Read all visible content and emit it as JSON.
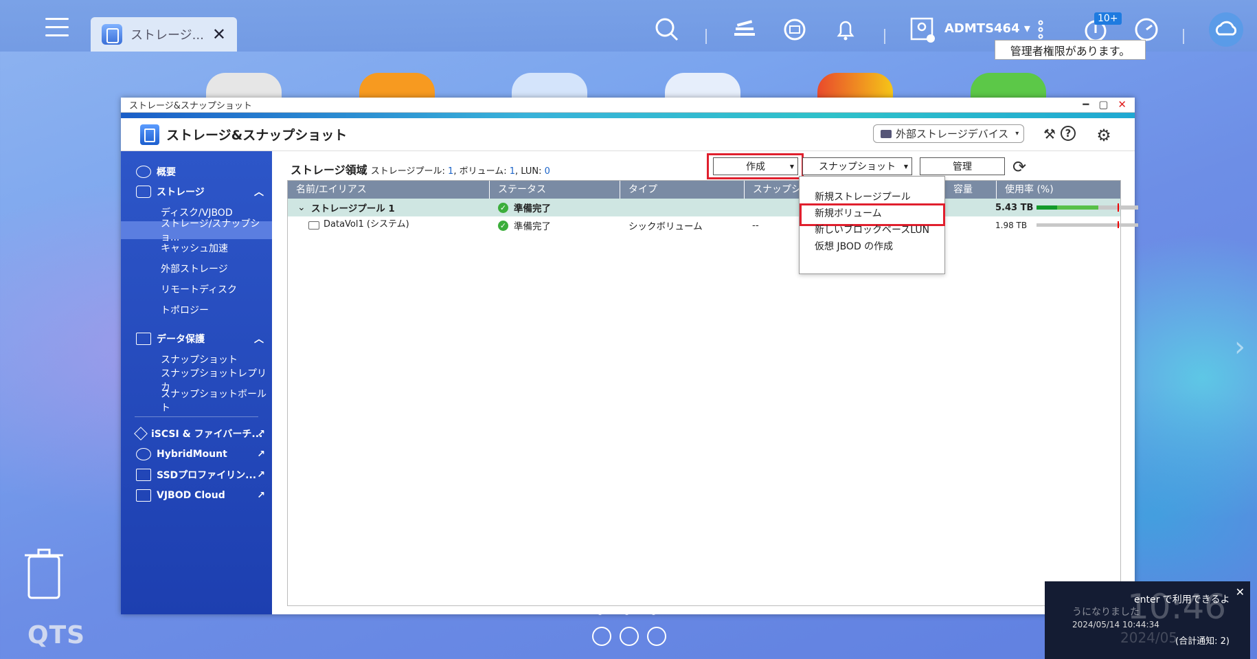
{
  "taskbar": {
    "tab_label": "ストレージ...",
    "tab_close": "✕",
    "user": "ADMTS464 ▾",
    "badge": "10+",
    "tooltip": "管理者権限があります。"
  },
  "window": {
    "titlebar": "ストレージ&スナップショット",
    "app_title": "ストレージ&スナップショット",
    "ext_device": "外部ストレージデバイス",
    "min": "━",
    "max": "▢",
    "close": "✕"
  },
  "sidebar": {
    "overview": "概要",
    "storage": "ストレージ",
    "storage_items": [
      "ディスク/VJBOD",
      "ストレージ/スナップショ...",
      "キャッシュ加速",
      "外部ストレージ",
      "リモートディスク",
      "トポロジー"
    ],
    "data_protect": "データ保護",
    "protect_items": [
      "スナップショット",
      "スナップショットレプリカ",
      "スナップショットボールト"
    ],
    "links": [
      "iSCSI & ファイバーチ...",
      "HybridMount",
      "SSDプロファイリン...",
      "VJBOD Cloud"
    ]
  },
  "content": {
    "title": "ストレージ領域",
    "summary_pool_label": "ストレージプール: ",
    "summary_pool": "1",
    "summary_vol_label": ", ボリューム: ",
    "summary_vol": "1",
    "summary_lun_label": ", LUN: ",
    "summary_lun": "0",
    "btn_create": "作成",
    "btn_snapshot": "スナップショット",
    "btn_manage": "管理",
    "columns": [
      "名前/エイリアス",
      "ステータス",
      "タイプ",
      "スナップシ",
      "容量",
      "使用率 (%)"
    ],
    "rows": [
      {
        "name": "ストレージプール 1",
        "status": "準備完了",
        "type": "",
        "snap": "",
        "capacity": "5.43 TB"
      },
      {
        "name": "DataVol1 (システム)",
        "status": "準備完了",
        "type": "シックボリューム",
        "snap": "--",
        "capacity": "1.98 TB"
      }
    ]
  },
  "dropdown": {
    "items": [
      "新規ストレージプール",
      "新規ボリューム",
      "新しいブロックベースLUN",
      "仮想 JBOD の作成"
    ]
  },
  "desktop": {
    "logo": "QTS",
    "notif_msg1": "enter で利用できるよ",
    "notif_msg2": "うになりました",
    "notif_time": "2024/05/14 10:44:34",
    "notif_total": "(合計通知: 2)",
    "clock_ghost": "10:46",
    "date_ghost": "2024/05"
  },
  "colors": {
    "accent": "#1d3fb0",
    "highlight": "#e01f2d",
    "ok": "#3cae3c",
    "bar_used": "#58c048",
    "bar_used_dark": "#139a2a"
  }
}
